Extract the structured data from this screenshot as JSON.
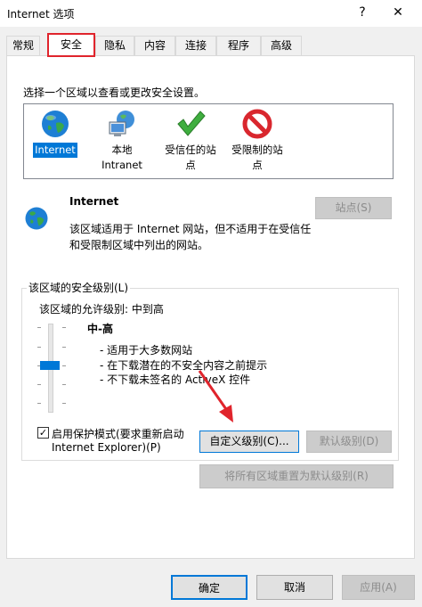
{
  "window": {
    "title": "Internet 选项",
    "help": "?",
    "close": "✕"
  },
  "tabs": [
    "常规",
    "安全",
    "隐私",
    "内容",
    "连接",
    "程序",
    "高级"
  ],
  "instructions": "选择一个区域以查看或更改安全设置。",
  "zones": [
    {
      "label_lines": [
        "Internet"
      ],
      "icon": "globe-icon",
      "selected": true
    },
    {
      "label_lines": [
        "本地",
        "Intranet"
      ],
      "icon": "local-intranet-icon",
      "selected": false
    },
    {
      "label_lines": [
        "受信任的站",
        "点"
      ],
      "icon": "trusted-sites-icon",
      "selected": false
    },
    {
      "label_lines": [
        "受限制的站",
        "点"
      ],
      "icon": "restricted-sites-icon",
      "selected": false
    }
  ],
  "zone_detail": {
    "name": "Internet",
    "desc_lines": [
      "该区域适用于 Internet 网站，但不适用于在受信任",
      "和受限制区域中列出的网站。"
    ],
    "sites_button": "站点(S)"
  },
  "security": {
    "group_title": "该区域的安全级别(L)",
    "allowed_label": "该区域的允许级别: 中到高",
    "level_name": "中-高",
    "bullets": [
      "- 适用于大多数网站",
      "- 在下载潜在的不安全内容之前提示",
      "- 不下载未签名的 ActiveX 控件"
    ],
    "protected_mode_lines": [
      "启用保护模式(要求重新启动",
      "Internet Explorer)(P)"
    ],
    "protected_mode_checked": true,
    "custom_level_button": "自定义级别(C)...",
    "default_level_button": "默认级别(D)",
    "reset_all_button": "将所有区域重置为默认级别(R)"
  },
  "footer": {
    "ok": "确定",
    "cancel": "取消",
    "apply": "应用(A)"
  },
  "colors": {
    "selection": "#0078d7",
    "highlight": "#e0242c"
  }
}
